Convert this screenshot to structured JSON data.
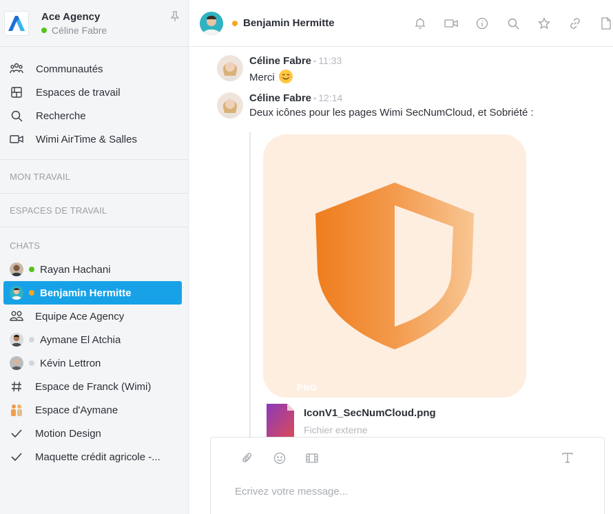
{
  "org": {
    "name": "Ace Agency",
    "user": "Céline Fabre"
  },
  "nav": [
    {
      "label": "Communautés",
      "icon": "communities-icon"
    },
    {
      "label": "Espaces de travail",
      "icon": "workspaces-icon"
    },
    {
      "label": "Recherche",
      "icon": "search-icon"
    },
    {
      "label": "Wimi AirTime & Salles",
      "icon": "video-icon"
    }
  ],
  "sections": {
    "work": "MON TRAVAIL",
    "spaces": "ESPACES DE TRAVAIL",
    "chats": "CHATS"
  },
  "chats": [
    {
      "label": "Rayan Hachani",
      "status": "online"
    },
    {
      "label": "Benjamin Hermitte",
      "status": "away",
      "active": true
    },
    {
      "label": "Equipe Ace Agency",
      "icon": "group-icon"
    },
    {
      "label": "Aymane El Atchia",
      "status": "offline"
    },
    {
      "label": "Kévin Lettron",
      "status": "offline"
    },
    {
      "label": "Espace de Franck (Wimi)",
      "icon": "hash-icon"
    },
    {
      "label": "Espace d'Aymane",
      "icon": "people-avatar-icon"
    },
    {
      "label": "Motion Design",
      "icon": "check-icon"
    },
    {
      "label": "Maquette crédit agricole -...",
      "icon": "check-icon"
    }
  ],
  "header": {
    "title": "Benjamin Hermitte",
    "icons": [
      "bell-icon",
      "video-icon",
      "info-icon",
      "search-icon",
      "star-icon",
      "link-icon",
      "file-icon"
    ]
  },
  "messages": [
    {
      "author": "Céline Fabre",
      "time": "11:33",
      "text": "Merci"
    },
    {
      "author": "Céline Fabre",
      "time": "12:14",
      "text": "Deux icônes pour les pages Wimi SecNumCloud, et Sobriété :"
    }
  ],
  "attachment": {
    "file_name": "IconV1_SecNumCloud.png",
    "file_type": "Fichier externe",
    "badge": "PNG"
  },
  "composer": {
    "placeholder": "Ecrivez votre message..."
  },
  "colors": {
    "accent": "#17a2e8",
    "online": "#52c41a",
    "away": "#f5a623",
    "shield": "#ef7d1e"
  }
}
